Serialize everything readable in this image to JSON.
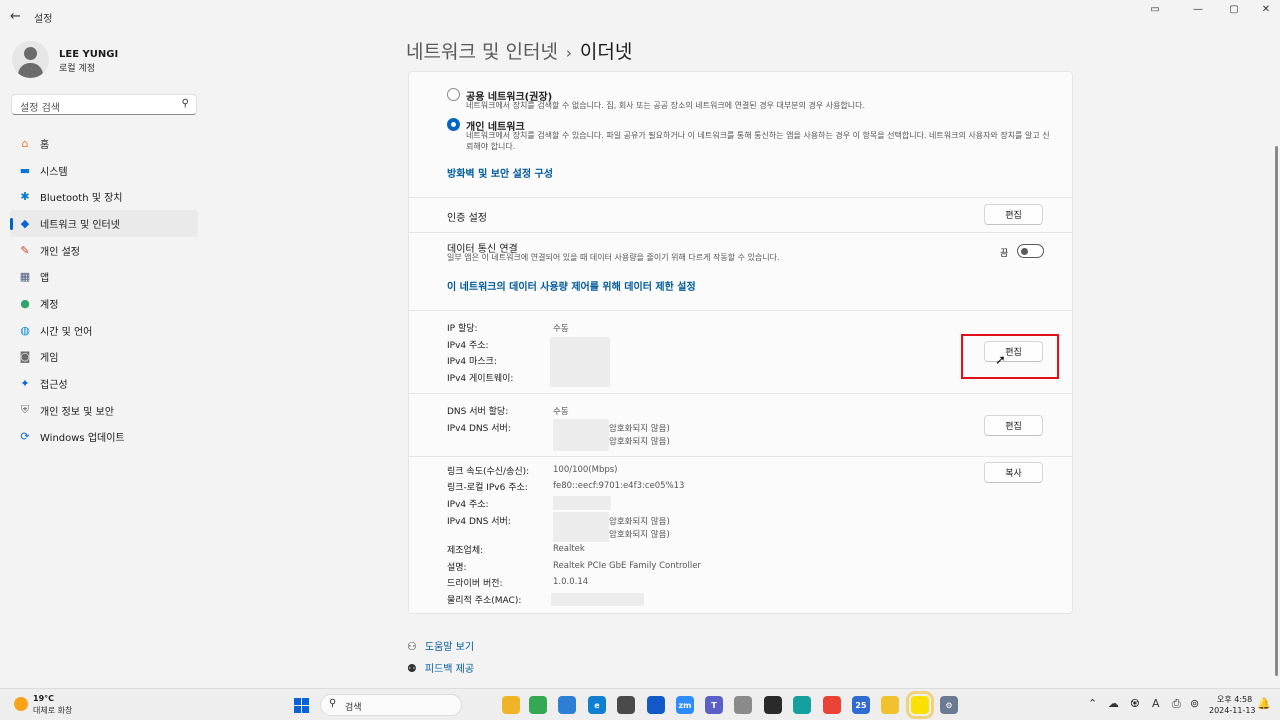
{
  "window": {
    "title": "설정",
    "back_glyph": "←",
    "controls": [
      "▭",
      "—",
      "▢",
      "✕"
    ]
  },
  "profile": {
    "name": "LEE YUNGI",
    "account_type": "로컬 계정"
  },
  "search": {
    "placeholder": "설정 검색"
  },
  "nav": {
    "items": [
      {
        "label": "홈",
        "icon": "home-icon",
        "glyph": "⌂",
        "color": "#e87a2a",
        "active": false
      },
      {
        "label": "시스템",
        "icon": "monitor-icon",
        "glyph": "▬",
        "color": "#0078d4",
        "active": false
      },
      {
        "label": "Bluetooth 및 장치",
        "icon": "bluetooth-icon",
        "glyph": "✱",
        "color": "#0078d4",
        "active": false
      },
      {
        "label": "네트워크 및 인터넷",
        "icon": "wifi-icon",
        "glyph": "◆",
        "color": "#0a63d6",
        "active": true
      },
      {
        "label": "개인 설정",
        "icon": "brush-icon",
        "glyph": "✎",
        "color": "#c24d2c",
        "active": false
      },
      {
        "label": "앱",
        "icon": "apps-icon",
        "glyph": "▦",
        "color": "#4a5a80",
        "active": false
      },
      {
        "label": "계정",
        "icon": "person-icon",
        "glyph": "●",
        "color": "#2fa56a",
        "active": false
      },
      {
        "label": "시간 및 언어",
        "icon": "globe-clock-icon",
        "glyph": "◍",
        "color": "#0a8ad6",
        "active": false
      },
      {
        "label": "게임",
        "icon": "gamepad-icon",
        "glyph": "◙",
        "color": "#6b6b6b",
        "active": false
      },
      {
        "label": "접근성",
        "icon": "accessibility-icon",
        "glyph": "✦",
        "color": "#0a63d6",
        "active": false
      },
      {
        "label": "개인 정보 및 보안",
        "icon": "shield-icon",
        "glyph": "⛨",
        "color": "#7a7a7a",
        "active": false
      },
      {
        "label": "Windows 업데이트",
        "icon": "update-icon",
        "glyph": "⟳",
        "color": "#0a63d6",
        "active": false
      }
    ]
  },
  "breadcrumb": {
    "parent": "네트워크 및 인터넷",
    "separator": "›",
    "current": "이더넷"
  },
  "network_profile": {
    "public_label": "공용 네트워크(권장)",
    "public_desc": "네트워크에서 장치를 검색할 수 없습니다. 집, 회사 또는 공공 장소의 네트워크에 연결된 경우 대부분의 경우 사용합니다.",
    "private_label": "개인 네트워크",
    "private_desc": "네트워크에서 장치를 검색할 수 있습니다. 파일 공유가 필요하거나 이 네트워크를 통해 통신하는 앱을 사용하는 경우 이 항목을 선택합니다. 네트워크의 사용자와 장치를 알고 신뢰해야 합니다.",
    "selected": "private",
    "firewall_link": "방화벽 및 보안 설정 구성"
  },
  "auth": {
    "label": "인증 설정",
    "button": "편집"
  },
  "metered": {
    "label": "데이터 통신 연결",
    "desc": "일부 앱은 이 네트워크에 연결되어 있을 때 데이터 사용량을 줄이기 위해 다르게 작동할 수 있습니다.",
    "toggle_state": "끔",
    "limit_link": "이 네트워크의 데이터 사용량 제어를 위해 데이터 제한 설정"
  },
  "ip": {
    "assignment_label": "IP 할당:",
    "assignment_value": "수동",
    "ipv4_label": "IPv4 주소:",
    "mask_label": "IPv4 마스크:",
    "gateway_label": "IPv4 게이트웨이:",
    "button": "편집"
  },
  "dns": {
    "assignment_label": "DNS 서버 할당:",
    "assignment_value": "수동",
    "ipv4_dns_label": "IPv4 DNS 서버:",
    "enc1": "암호화되지 않음)",
    "enc2": "암호화되지 않음)",
    "button": "편집"
  },
  "properties": {
    "button": "복사",
    "link_speed_label": "링크 속도(수신/송신):",
    "link_speed_value": "100/100(Mbps)",
    "ipv6_label": "링크-로컬 IPv6 주소:",
    "ipv6_value": "fe80::eecf:9701:e4f3:ce05%13",
    "ipv4_label": "IPv4 주소:",
    "ipv4_dns_label": "IPv4 DNS 서버:",
    "enc1": "암호화되지 않음)",
    "enc2": "암호화되지 않음)",
    "manufacturer_label": "제조업체:",
    "manufacturer_value": "Realtek",
    "description_label": "설명:",
    "description_value": "Realtek PCIe GbE Family Controller",
    "driver_label": "드라이버 버전:",
    "driver_value": "1.0.0.14",
    "mac_label": "물리적 주소(MAC):"
  },
  "help": {
    "get_help": "도움말 보기",
    "feedback": "피드백 제공"
  },
  "taskbar": {
    "weather_temp": "19°C",
    "weather_desc": "대체로 화창",
    "search_label": "검색",
    "apps": [
      {
        "name": "file-explorer-icon",
        "color": "#f0b429",
        "glyph": ""
      },
      {
        "name": "chrome-icon",
        "color": "#34a853",
        "glyph": ""
      },
      {
        "name": "notepad-icon",
        "color": "#2c7fd4",
        "glyph": ""
      },
      {
        "name": "edge-icon",
        "color": "#0f7fd1",
        "glyph": "e"
      },
      {
        "name": "tool-icon",
        "color": "#4a4a4a",
        "glyph": ""
      },
      {
        "name": "app-blue-icon",
        "color": "#1459c8",
        "glyph": ""
      },
      {
        "name": "zoom-icon",
        "color": "#2d8cff",
        "glyph": "zm"
      },
      {
        "name": "teams-icon",
        "color": "#5b5fc7",
        "glyph": "T"
      },
      {
        "name": "app-gray-icon",
        "color": "#8a8a8a",
        "glyph": ""
      },
      {
        "name": "app-dark-icon",
        "color": "#2a2a2a",
        "glyph": ""
      },
      {
        "name": "app-cyan-icon",
        "color": "#15a0a0",
        "glyph": ""
      },
      {
        "name": "chrome-2-icon",
        "color": "#ea4335",
        "glyph": ""
      },
      {
        "name": "calendar-icon",
        "color": "#2f6bd0",
        "glyph": "25"
      },
      {
        "name": "app-yellow-icon",
        "color": "#f2c12e",
        "glyph": ""
      },
      {
        "name": "kakaotalk-icon",
        "color": "#f9e000",
        "glyph": ""
      },
      {
        "name": "settings-icon",
        "color": "#6a7a90",
        "glyph": "⚙"
      }
    ],
    "tray": [
      "⌃",
      "☁",
      "♼",
      "A",
      "⎙",
      "⊚",
      "🔊"
    ],
    "time": "오후 4:58",
    "date": "2024-11-13"
  }
}
